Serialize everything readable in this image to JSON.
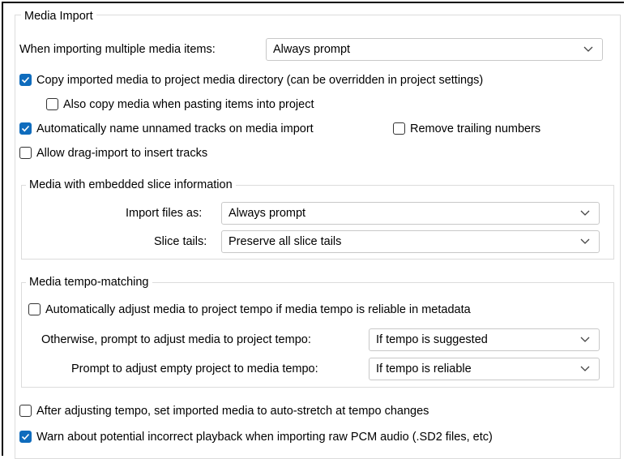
{
  "media_import": {
    "legend": "Media Import",
    "multiple_items": {
      "label": "When importing multiple media items:",
      "value": "Always prompt"
    },
    "options": {
      "copy_to_project_dir": {
        "label": "Copy imported media to project media directory (can be overridden in project settings)",
        "checked": true
      },
      "copy_when_pasting": {
        "label": "Also copy media when pasting items into project",
        "checked": false
      },
      "auto_name_tracks": {
        "label": "Automatically name unnamed tracks on media import",
        "checked": true
      },
      "remove_trailing_numbers": {
        "label": "Remove trailing numbers",
        "checked": false
      },
      "drag_import_insert": {
        "label": "Allow drag-import to insert tracks",
        "checked": false
      },
      "auto_stretch": {
        "label": "After adjusting tempo, set imported media to auto-stretch at tempo changes",
        "checked": false
      },
      "warn_raw_pcm": {
        "label": "Warn about potential incorrect playback when importing raw PCM audio (.SD2 files, etc)",
        "checked": true
      }
    }
  },
  "slice_info": {
    "legend": "Media with embedded slice information",
    "import_files_as": {
      "label": "Import files as:",
      "value": "Always prompt"
    },
    "slice_tails": {
      "label": "Slice tails:",
      "value": "Preserve all slice tails"
    }
  },
  "tempo_matching": {
    "legend": "Media tempo-matching",
    "auto_adjust": {
      "label": "Automatically adjust media to project tempo if media tempo is reliable in metadata",
      "checked": false
    },
    "otherwise_prompt": {
      "label": "Otherwise, prompt to adjust media to project tempo:",
      "value": "If tempo is suggested"
    },
    "empty_project_prompt": {
      "label": "Prompt to adjust empty project to media tempo:",
      "value": "If tempo is reliable"
    }
  },
  "colors": {
    "accent": "#0f6cbd",
    "border": "#dcdcdc"
  },
  "icons": {
    "dropdown": "chevron-down-icon",
    "check": "checkmark-icon"
  }
}
